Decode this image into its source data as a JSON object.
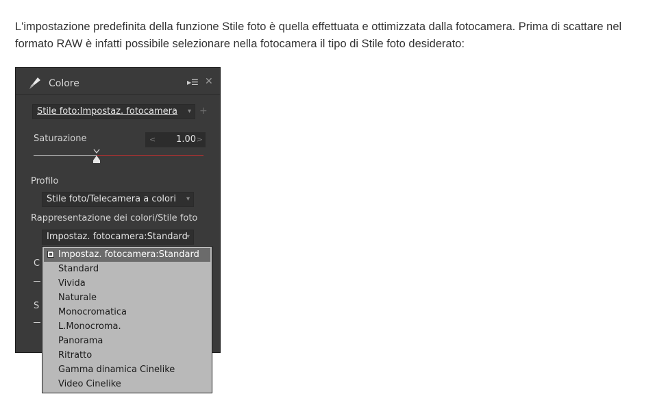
{
  "intro": {
    "text": "L'impostazione predefinita della funzione Stile foto è quella effettuata e ottimizzata dalla fotocamera. Prima di scattare nel formato RAW è infatti possibile selezionare nella fotocamera il tipo di Stile foto desiderato:"
  },
  "panel": {
    "title": "Colore",
    "menu_icon": "▸☰",
    "close_icon": "✕",
    "photo_style_combo": "Stile foto:Impostaz. fotocamera",
    "add_icon": "+",
    "saturation": {
      "label": "Saturazione",
      "value": "1.00",
      "left_arrow": "<",
      "right_arrow": ">",
      "slider_fraction": 0.37
    },
    "profile": {
      "label": "Profilo",
      "value": "Stile foto/Telecamera a colori"
    },
    "color_repr": {
      "label": "Rappresentazione dei colori/Stile foto",
      "value": "Impostaz. fotocamera:Standard"
    },
    "hidden_labels": {
      "c": "C",
      "s": "S"
    }
  },
  "dropdown": {
    "selected_index": 0,
    "options": [
      "Impostaz. fotocamera:Standard",
      "Standard",
      "Vivida",
      "Naturale",
      "Monocromatica",
      "L.Monocroma.",
      "Panorama",
      "Ritratto",
      "Gamma dinamica Cinelike",
      "Video Cinelike"
    ]
  },
  "colors": {
    "panel_bg": "#3a3a3a",
    "slider_accent": "#c83030",
    "dropdown_bg": "#b9b9b9",
    "dropdown_selected": "#6b6b6b"
  }
}
